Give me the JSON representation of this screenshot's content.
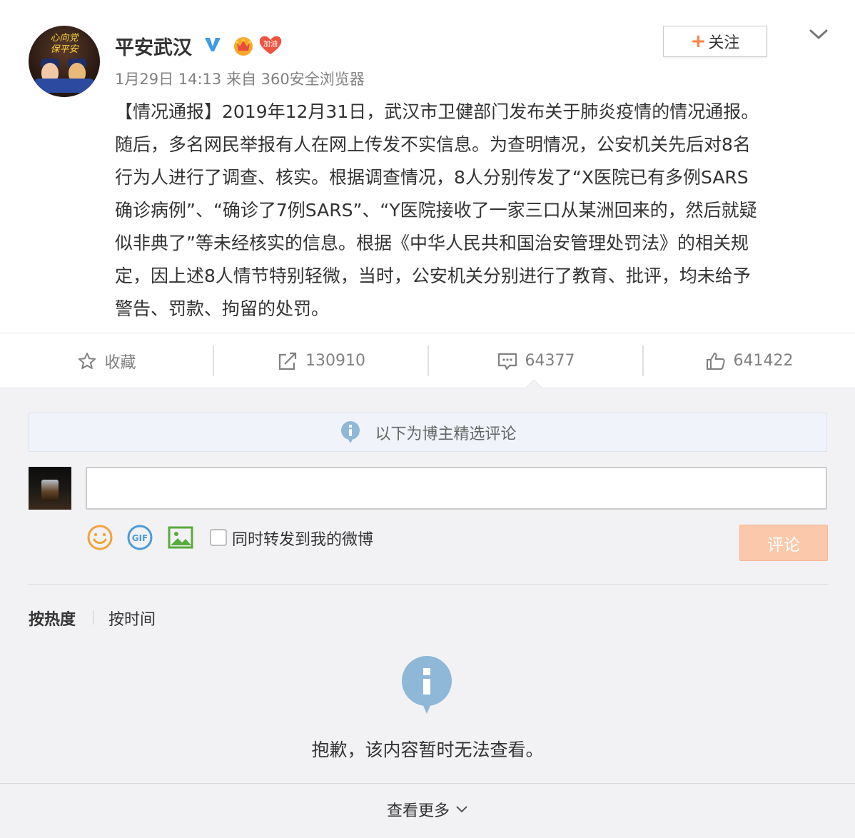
{
  "post": {
    "username": "平安武汉",
    "avatar_text_line1": "心向党",
    "avatar_text_line2": "保平安",
    "badge_jiayou": "加油",
    "follow_label": "关注",
    "follow_plus": "+",
    "timestamp": "1月29日 14:13",
    "source_prefix": "来自",
    "source": "360安全浏览器",
    "text_lines": [
      "【情况通报】2019年12月31日，武汉市卫健部门发布关于肺炎疫情的情况通报。",
      "随后，多名网民举报有人在网上传发不实信息。为查明情况，公安机关先后对8名",
      "行为人进行了调查、核实。根据调查情况，8人分别传发了“X医院已有多例SARS",
      "确诊病例”、“确诊了7例SARS”、“Y医院接收了一家三口从某洲回来的，然后就疑",
      "似非典了”等未经核实的信息。根据《中华人民共和国治安管理处罚法》的相关规",
      "定，因上述8人情节特别轻微，当时，公安机关分别进行了教育、批评，均未给予",
      "警告、罚款、拘留的处罚。"
    ]
  },
  "actions": {
    "favorite_label": "收藏",
    "repost_count": "130910",
    "comment_count": "64377",
    "like_count": "641422"
  },
  "comments": {
    "notice": "以下为博主精选评论",
    "input_value": "",
    "repost_checkbox_label": "同时转发到我的微博",
    "submit_label": "评论",
    "sort_hot": "按热度",
    "sort_time": "按时间",
    "empty_message": "抱歉，该内容暂时无法查看。",
    "more_label": "查看更多"
  },
  "colors": {
    "accent_orange": "#ff8140",
    "submit_disabled": "#fbc8ab",
    "info_blue": "#8fb8d8",
    "verified_blue": "#3f9be8"
  },
  "icons": {
    "verified": "verified-v-icon",
    "vip": "crown-vip-icon",
    "jiayou": "heart-jiayou-icon",
    "favorite": "star-icon",
    "repost": "share-arrow-icon",
    "comment": "speech-bubble-icon",
    "like": "thumbs-up-icon",
    "info": "info-icon",
    "emoji": "smiley-icon",
    "gif": "gif-icon",
    "picture": "picture-icon",
    "dropdown": "chevron-down-icon"
  }
}
